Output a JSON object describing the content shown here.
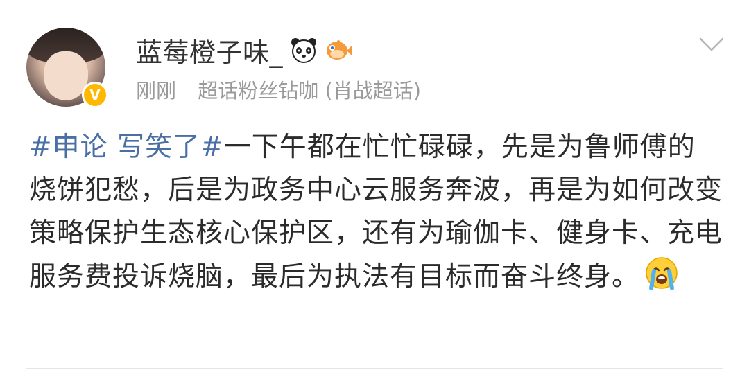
{
  "post": {
    "author": {
      "name": "蓝莓橙子味_",
      "badge_icons": [
        "panda-icon",
        "pufferfish-icon"
      ],
      "verified_icon": "verified-badge-icon",
      "avatar_icon": "avatar-photo"
    },
    "meta": {
      "time": "刚刚",
      "source": "超话粉丝钻咖 (肖战超话)"
    },
    "body": {
      "topic": "#申论 写笑了#",
      "text": "一下午都在忙忙碌碌，先是为鲁师傅的烧饼犯愁，后是为政务中心云服务奔波，再是为如何改变策略保护生态核心保护区，还有为瑜伽卡、健身卡、充电服务费投诉烧脑，最后为执法有目标而奋斗终身。",
      "trailing_emoji": "crying-face-icon"
    },
    "colors": {
      "topic_link": "#4a6fa5",
      "meta_gray": "#9a9a9a",
      "verified": "#ffb800"
    }
  }
}
